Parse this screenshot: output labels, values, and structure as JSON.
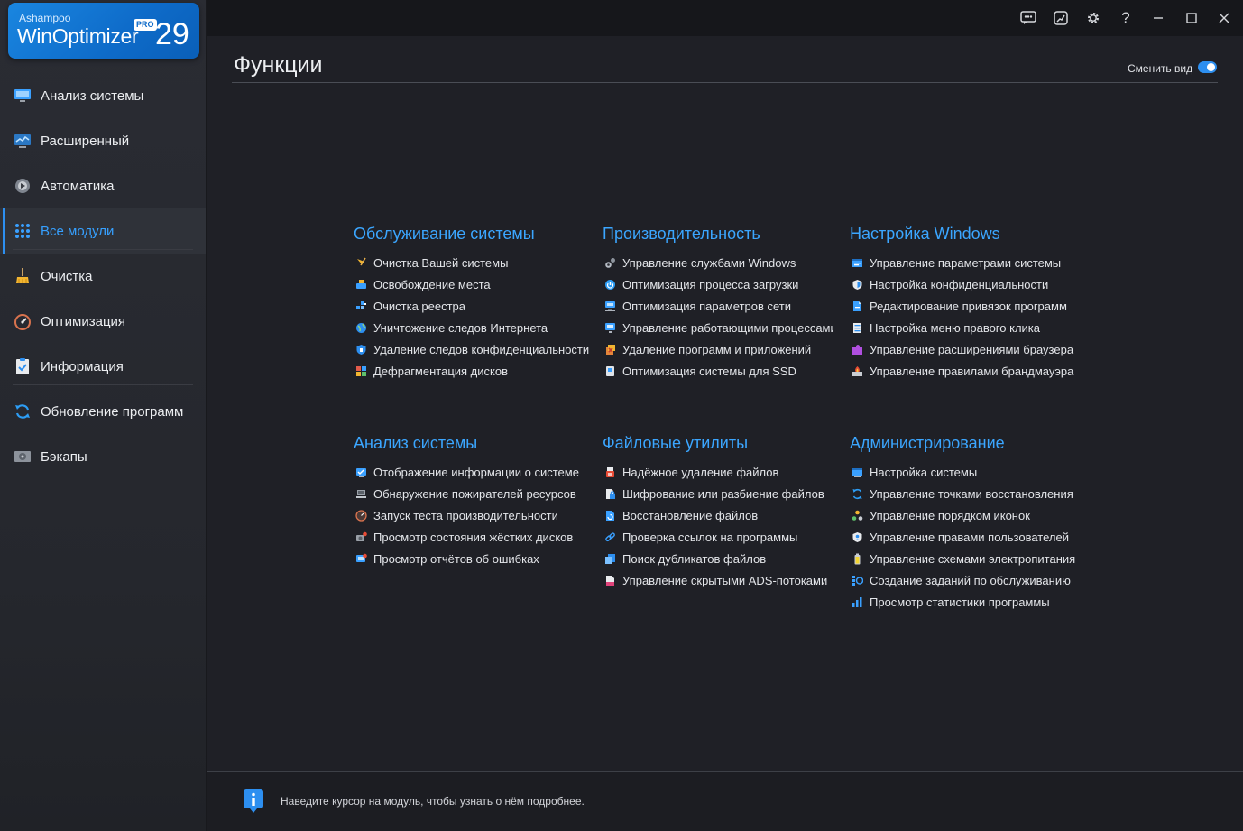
{
  "logo": {
    "brand": "Ashampoo",
    "product": "WinOptimizer",
    "version": "29",
    "edition": "PRO"
  },
  "sidebar": {
    "items": [
      {
        "label": "Анализ системы",
        "icon": "monitor-icon"
      },
      {
        "label": "Расширенный",
        "icon": "chart-monitor-icon"
      },
      {
        "label": "Автоматика",
        "icon": "play-gear-icon"
      },
      {
        "label": "Все модули",
        "icon": "grid-icon",
        "active": true
      },
      {
        "label": "Очистка",
        "icon": "broom-icon"
      },
      {
        "label": "Оптимизация",
        "icon": "speedometer-icon"
      },
      {
        "label": "Информация",
        "icon": "clipboard-check-icon"
      },
      {
        "label": "Обновление программ",
        "icon": "refresh-icon"
      },
      {
        "label": "Бэкапы",
        "icon": "drive-icon"
      }
    ]
  },
  "titlebar": {
    "buttons": [
      "feedback-icon",
      "graph-icon",
      "settings-icon",
      "help-icon",
      "minimize-icon",
      "maximize-icon",
      "close-icon"
    ],
    "help_label": "?"
  },
  "main": {
    "title": "Функции",
    "toggle_label": "Сменить вид",
    "groups": [
      {
        "title": "Обслуживание системы",
        "items": [
          "Очистка Вашей системы",
          "Освобождение места",
          "Очистка реестра",
          "Уничтожение следов Интернета",
          "Удаление следов конфиденциальности",
          "Дефрагментация дисков"
        ]
      },
      {
        "title": "Производительность",
        "items": [
          "Управление службами Windows",
          "Оптимизация процесса загрузки",
          "Оптимизация параметров сети",
          "Управление работающими процессами",
          "Удаление программ и приложений",
          "Оптимизация системы для SSD"
        ]
      },
      {
        "title": "Настройка Windows",
        "items": [
          "Управление параметрами системы",
          "Настройка конфиденциальности",
          "Редактирование привязок программ",
          "Настройка меню правого клика",
          "Управление расширениями браузера",
          "Управление правилами брандмауэра"
        ]
      },
      {
        "title": "Анализ системы",
        "items": [
          "Отображение информации о системе",
          "Обнаружение пожирателей ресурсов",
          "Запуск теста производительности",
          "Просмотр состояния жёстких дисков",
          "Просмотр отчётов об ошибках"
        ]
      },
      {
        "title": "Файловые утилиты",
        "items": [
          "Надёжное удаление файлов",
          "Шифрование или разбиение файлов",
          "Восстановление файлов",
          "Проверка ссылок на программы",
          "Поиск дубликатов файлов",
          "Управление скрытыми ADS-потоками"
        ]
      },
      {
        "title": "Администрирование",
        "items": [
          "Настройка системы",
          "Управление точками восстановления",
          "Управление порядком иконок",
          "Управление правами пользователей",
          "Управление схемами электропитания",
          "Создание заданий по обслуживанию",
          "Просмотр статистики программы"
        ]
      }
    ]
  },
  "footer": {
    "hint": "Наведите курсор на модуль, чтобы узнать о нём подробнее."
  },
  "colors": {
    "accent": "#2d8ff0",
    "heading": "#3ba6ff",
    "background": "#1f2026",
    "sidebar": "#2a2c33"
  }
}
